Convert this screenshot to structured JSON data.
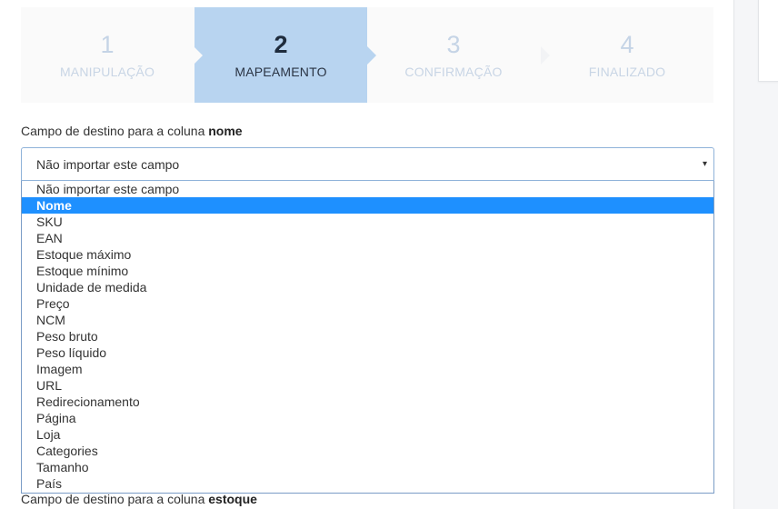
{
  "steps": [
    {
      "number": "1",
      "label": "MANIPULAÇÃO"
    },
    {
      "number": "2",
      "label": "MAPEAMENTO"
    },
    {
      "number": "3",
      "label": "CONFIRMAÇÃO"
    },
    {
      "number": "4",
      "label": "FINALIZADO"
    }
  ],
  "active_step": 2,
  "field1": {
    "label_prefix": "Campo de destino para a coluna",
    "column": "nome",
    "selected_value": "Não importar este campo"
  },
  "field2": {
    "label_prefix": "Campo de destino para a coluna",
    "column": "estoque"
  },
  "dropdown_options": [
    "Não importar este campo",
    "Nome",
    "SKU",
    "EAN",
    "Estoque máximo",
    "Estoque mínimo",
    "Unidade de medida",
    "Preço",
    "NCM",
    "Peso bruto",
    "Peso líquido",
    "Imagem",
    "URL",
    "Redirecionamento",
    "Página",
    "Loja",
    "Categories",
    "Tamanho",
    "País"
  ],
  "highlighted_option": "Nome",
  "colors": {
    "active_step_bg": "#b8d4f0",
    "highlight": "#1e90ff",
    "inactive_step_text": "#c8d5e5"
  },
  "icons": {
    "dropdown_caret": "▾"
  }
}
